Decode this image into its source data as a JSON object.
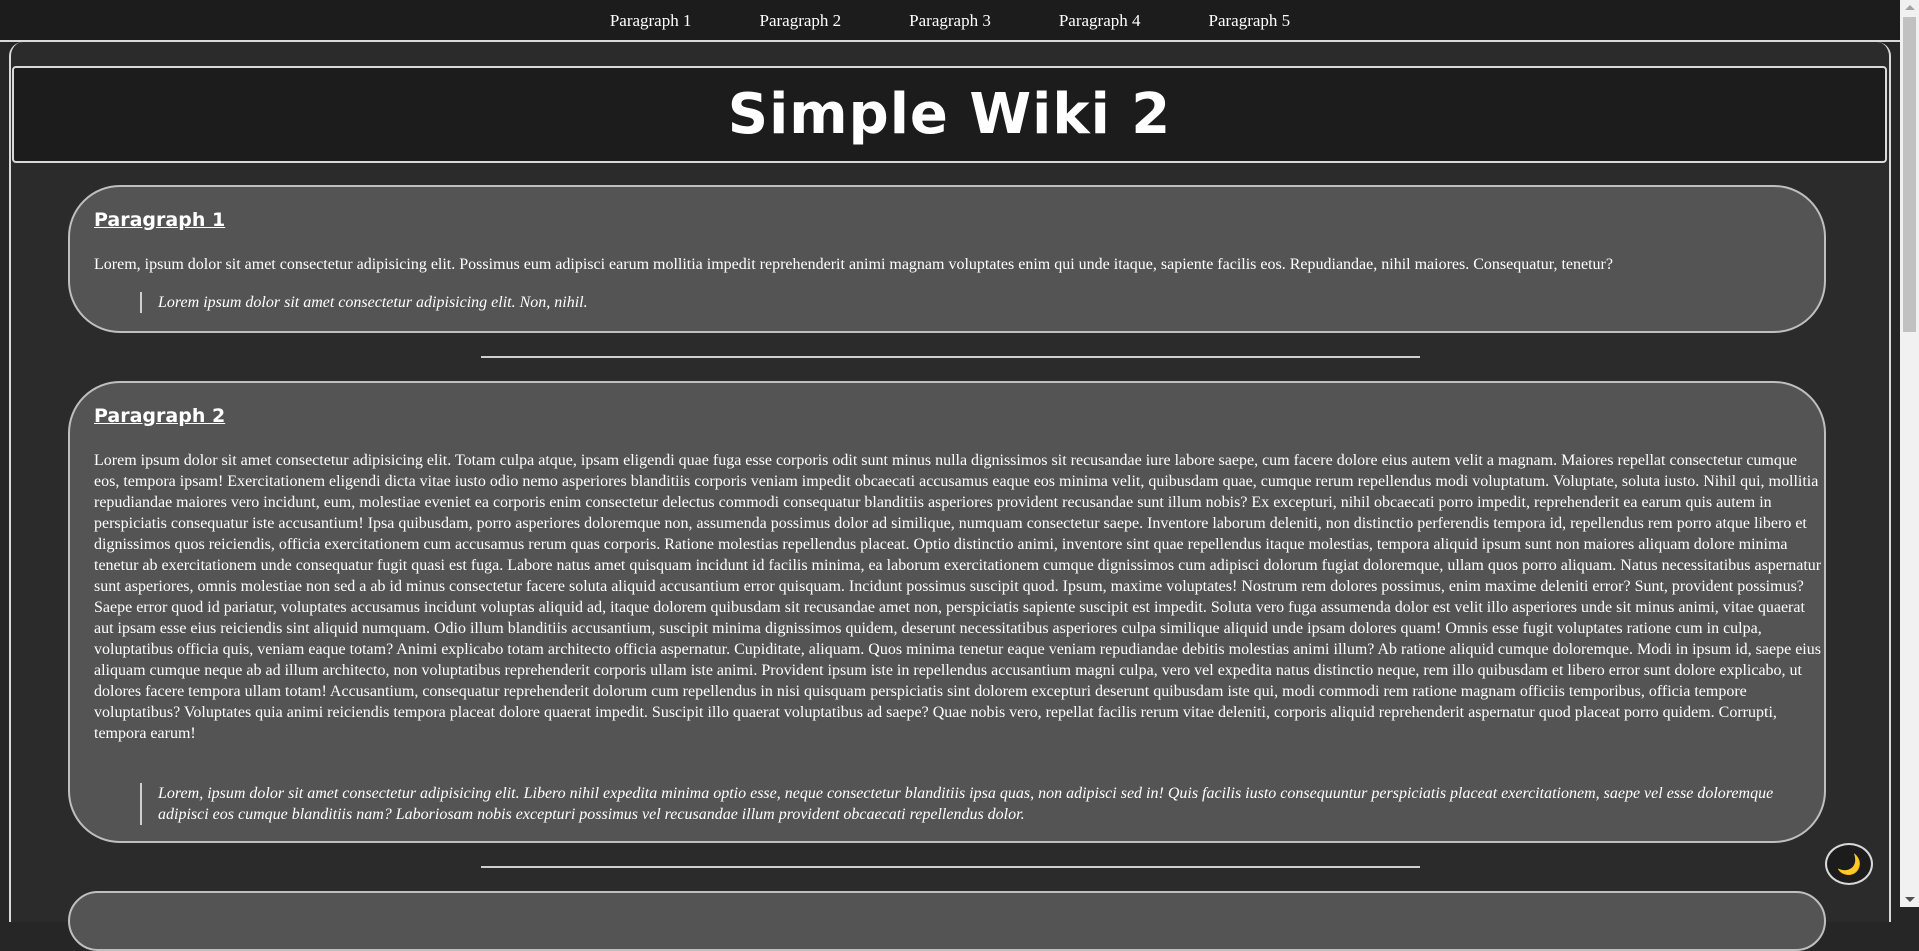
{
  "nav": {
    "items": [
      "Paragraph 1",
      "Paragraph 2",
      "Paragraph 3",
      "Paragraph 4",
      "Paragraph 5"
    ]
  },
  "header": {
    "title": "Simple Wiki 2"
  },
  "sections": [
    {
      "heading": "Paragraph 1",
      "body": "Lorem, ipsum dolor sit amet consectetur adipisicing elit. Possimus eum adipisci earum mollitia impedit reprehenderit animi magnam voluptates enim qui unde itaque, sapiente facilis eos. Repudiandae, nihil maiores. Consequatur, tenetur?",
      "quote": "Lorem ipsum dolor sit amet consectetur adipisicing elit. Non, nihil."
    },
    {
      "heading": "Paragraph 2",
      "body": "Lorem ipsum dolor sit amet consectetur adipisicing elit. Totam culpa atque, ipsam eligendi quae fuga esse corporis odit sunt minus nulla dignissimos sit recusandae iure labore saepe, cum facere dolore eius autem velit a magnam. Maiores repellat consectetur cumque eos, tempora ipsam! Exercitationem eligendi dicta vitae iusto odio nemo asperiores blanditiis corporis veniam impedit obcaecati accusamus eaque eos minima velit, quibusdam quae, cumque rerum repellendus modi voluptatum. Voluptate, soluta iusto. Nihil qui, mollitia repudiandae maiores vero incidunt, eum, molestiae eveniet ea corporis enim consectetur delectus commodi consequatur blanditiis asperiores provident recusandae sunt illum nobis? Ex excepturi, nihil obcaecati porro impedit, reprehenderit ea earum quis autem in perspiciatis consequatur iste accusantium! Ipsa quibusdam, porro asperiores doloremque non, assumenda possimus dolor ad similique, numquam consectetur saepe. Inventore laborum deleniti, non distinctio perferendis tempora id, repellendus rem porro atque libero et dignissimos quos reiciendis, officia exercitationem cum accusamus rerum quas corporis. Ratione molestias repellendus placeat. Optio distinctio animi, inventore sint quae repellendus itaque molestias, tempora aliquid ipsum sunt non maiores aliquam dolore minima tenetur ab exercitationem unde consequatur fugit quasi est fuga. Labore natus amet quisquam incidunt id facilis minima, ea laborum exercitationem cumque dignissimos cum adipisci dolorum fugiat doloremque, ullam quos porro aliquam. Natus necessitatibus aspernatur sunt asperiores, omnis molestiae non sed a ab id minus consectetur facere soluta aliquid accusantium error quisquam. Incidunt possimus suscipit quod. Ipsum, maxime voluptates! Nostrum rem dolores possimus, enim maxime deleniti error? Sunt, provident possimus? Saepe error quod id pariatur, voluptates accusamus incidunt voluptas aliquid ad, itaque dolorem quibusdam sit recusandae amet non, perspiciatis sapiente suscipit est impedit. Soluta vero fuga assumenda dolor est velit illo asperiores unde sit minus animi, vitae quaerat aut ipsam esse eius reiciendis sint aliquid numquam. Odio illum blanditiis accusantium, suscipit minima dignissimos quidem, deserunt necessitatibus asperiores culpa similique aliquid unde ipsam dolores quam! Omnis esse fugit voluptates ratione cum in culpa, voluptatibus officia quis, veniam eaque totam? Animi explicabo totam architecto officia aspernatur. Cupiditate, aliquam. Quos minima tenetur eaque veniam repudiandae debitis molestias animi illum? Ab ratione aliquid cumque doloremque. Modi in ipsum id, saepe eius aliquam cumque neque ab ad illum architecto, non voluptatibus reprehenderit corporis ullam iste animi. Provident ipsum iste in repellendus accusantium magni culpa, vero vel expedita natus distinctio neque, rem illo quibusdam et libero error sunt dolore explicabo, ut dolores facere tempora ullam totam! Accusantium, consequatur reprehenderit dolorum cum repellendus in nisi quisquam perspiciatis sint dolorem excepturi deserunt quibusdam iste qui, modi commodi rem ratione magnam officiis temporibus, officia tempore voluptatibus? Voluptates quia animi reiciendis tempora placeat dolore quaerat impedit. Suscipit illo quaerat voluptatibus ad saepe? Quae nobis vero, repellat facilis rerum vitae deleniti, corporis aliquid reprehenderit aspernatur quod placeat porro quidem. Corrupti, tempora earum!",
      "quote": "Lorem, ipsum dolor sit amet consectetur adipisicing elit. Libero nihil expedita minima optio esse, neque consectetur blanditiis ipsa quas, non adipisci sed in! Quis facilis iusto consequuntur perspiciatis placeat exercitationem, saepe vel esse doloremque adipisci eos cumque blanditiis nam? Laboriosam nobis excepturi possimus vel recusandae illum provident obcaecati repellendus dolor."
    }
  ],
  "theme_toggle": {
    "icon": "moon-icon",
    "glyph": "🌙"
  },
  "colors": {
    "background": "#262626",
    "card": "#545454",
    "nav": "#1c1c1c"
  }
}
